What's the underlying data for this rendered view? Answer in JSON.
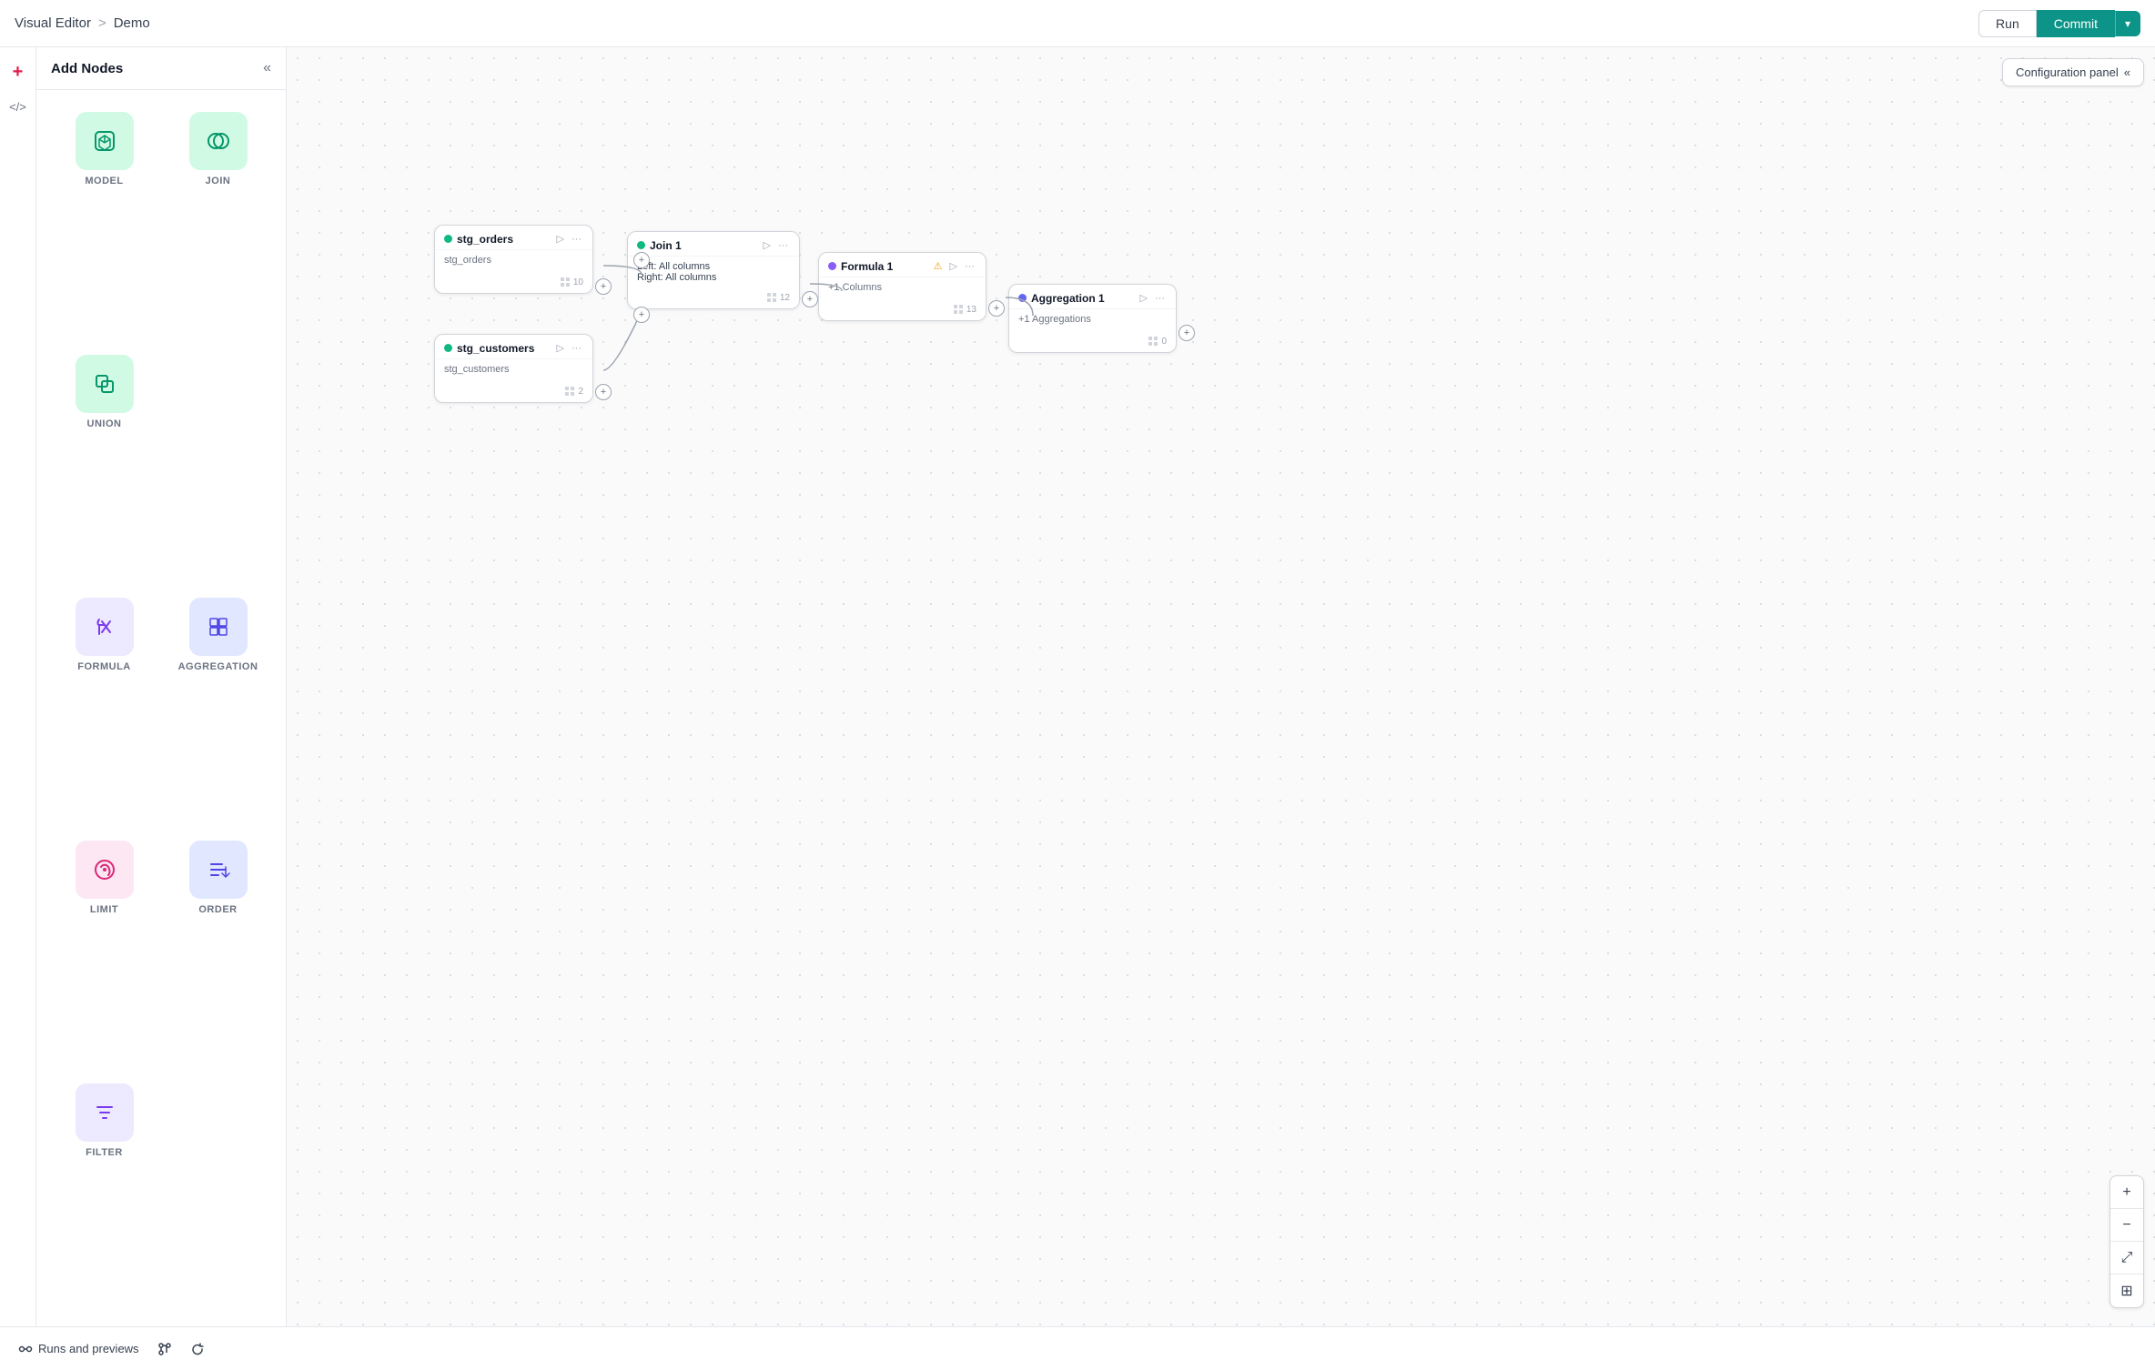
{
  "header": {
    "visual_editor_label": "Visual Editor",
    "separator": ">",
    "demo_label": "Demo",
    "run_label": "Run",
    "commit_label": "Commit",
    "dropdown_icon": "▾"
  },
  "sidebar": {
    "title": "Add Nodes",
    "collapse_icon": "«",
    "nodes": [
      {
        "id": "model",
        "label": "MODEL",
        "icon": "🧊",
        "icon_class": "icon-model"
      },
      {
        "id": "join",
        "label": "JOIN",
        "icon": "⊕",
        "icon_class": "icon-join"
      },
      {
        "id": "union",
        "label": "UNION",
        "icon": "⊔",
        "icon_class": "icon-union"
      },
      {
        "id": "formula",
        "label": "FORMULA",
        "icon": "⚗",
        "icon_class": "icon-formula"
      },
      {
        "id": "aggregation",
        "label": "AGGREGATION",
        "icon": "▦",
        "icon_class": "icon-aggregation"
      },
      {
        "id": "limit",
        "label": "LIMIT",
        "icon": "✧",
        "icon_class": "icon-limit"
      },
      {
        "id": "order",
        "label": "ORDER",
        "icon": "⇅",
        "icon_class": "icon-order"
      },
      {
        "id": "filter",
        "label": "FILTER",
        "icon": "☰",
        "icon_class": "icon-filter"
      }
    ]
  },
  "config_panel": {
    "label": "Configuration panel",
    "collapse_icon": "«"
  },
  "flow_nodes": {
    "stg_orders": {
      "title": "stg_orders",
      "subtitle": "stg_orders",
      "count": "10",
      "left": "162",
      "top": "195"
    },
    "stg_customers": {
      "title": "stg_customers",
      "subtitle": "stg_customers",
      "count": "2",
      "left": "162",
      "top": "315"
    },
    "join1": {
      "title": "Join 1",
      "left_label": "Left: All columns",
      "right_label": "Right: All columns",
      "count": "12",
      "left": "370",
      "top": "200"
    },
    "formula1": {
      "title": "Formula 1",
      "subtitle": "+1 Columns",
      "count": "13",
      "left": "580",
      "top": "225"
    },
    "aggregation1": {
      "title": "Aggregation 1",
      "subtitle": "+1 Aggregations",
      "count": "0",
      "left": "790",
      "top": "258"
    }
  },
  "zoom_controls": {
    "plus": "+",
    "minus": "−",
    "fit": "⤢",
    "grid": "⊞"
  },
  "bottom_bar": {
    "runs_label": "Runs and previews",
    "git_icon": "git",
    "refresh_icon": "↻"
  }
}
